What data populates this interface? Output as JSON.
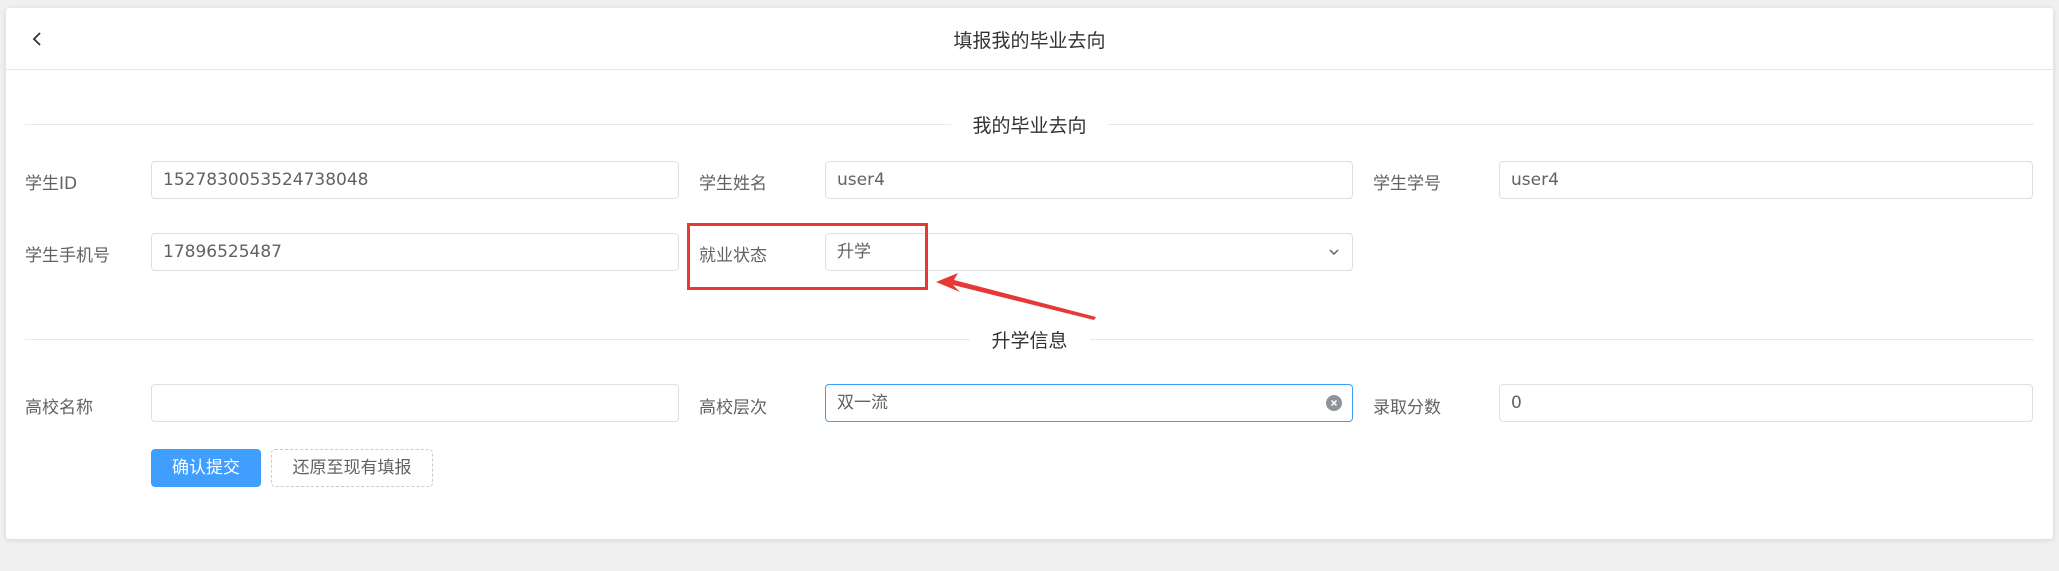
{
  "header": {
    "title": "填报我的毕业去向",
    "back_icon": "chevron-left-icon"
  },
  "section_main": {
    "title": "我的毕业去向",
    "fields": {
      "student_id": {
        "label": "学生ID",
        "value": "1527830053524738048"
      },
      "student_name": {
        "label": "学生姓名",
        "value": "user4"
      },
      "student_no": {
        "label": "学生学号",
        "value": "user4"
      },
      "student_phone": {
        "label": "学生手机号",
        "value": "17896525487"
      },
      "employment_status": {
        "label": "就业状态",
        "value": "升学"
      }
    }
  },
  "section_further": {
    "title": "升学信息",
    "fields": {
      "school_name": {
        "label": "高校名称",
        "value": ""
      },
      "school_level": {
        "label": "高校层次",
        "value": "双一流"
      },
      "admission_score": {
        "label": "录取分数",
        "value": "0"
      }
    }
  },
  "actions": {
    "submit_label": "确认提交",
    "restore_label": "还原至现有填报"
  },
  "colors": {
    "primary": "#409eff",
    "annotation": "#e53935",
    "border": "#dcdfe6",
    "background": "#f0f0f0"
  }
}
